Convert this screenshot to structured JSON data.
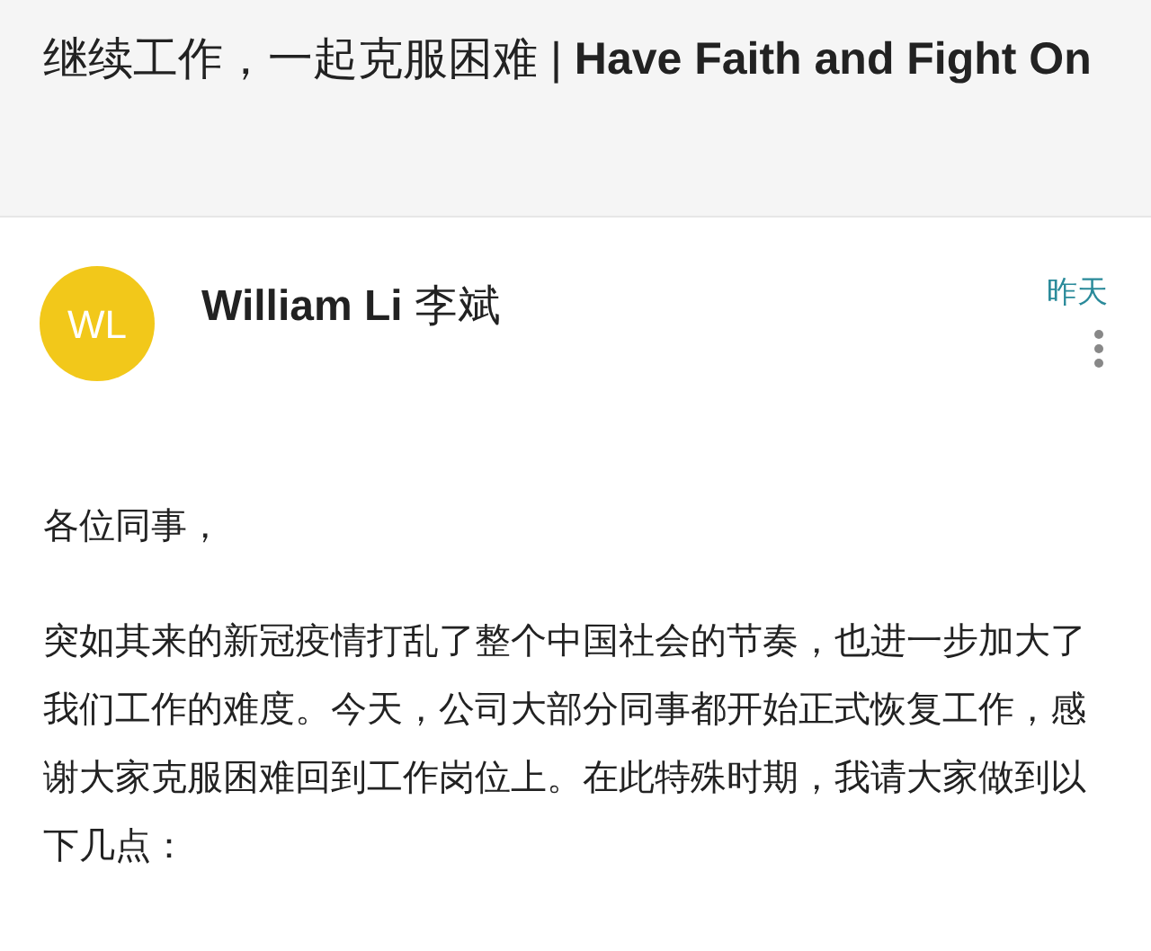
{
  "subject": "继续工作，一起克服困难 | **Have Faith and Fight On**",
  "sender": {
    "avatar_initials": "WL",
    "name": "**William Li** 李斌",
    "date": "昨天"
  },
  "body": [
    "各位同事，",
    "突如其来的新冠疫情打乱了整个中国社会的节奏，也进一步加大了我们工作的难度。今天，公司大部分同事都开始正式恢复工作，感谢大家克服困难回到工作岗位上。在此特殊时期，我请大家做到以下几点："
  ]
}
